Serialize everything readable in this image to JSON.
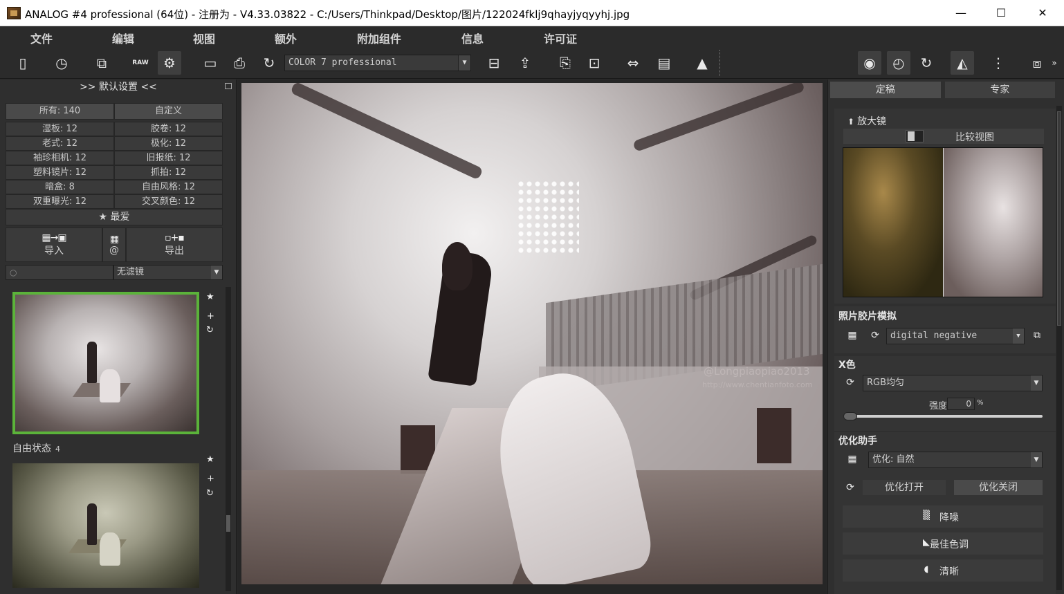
{
  "window": {
    "title": "ANALOG #4 professional (64位) - 注册为 - V4.33.03822 - C:/Users/Thinkpad/Desktop/图片/122024fklj9qhayjyqyyhj.jpg",
    "min_glyph": "—",
    "max_glyph": "☐",
    "close_glyph": "✕"
  },
  "menu": [
    "文件",
    "编辑",
    "视图",
    "额外",
    "附加组件",
    "信息",
    "许可证"
  ],
  "toolbar": {
    "preset": "COLOR 7 professional",
    "raw_label": "RAW"
  },
  "left_panel": {
    "header": ">> 默认设置 <<",
    "categories": [
      [
        "所有: 140",
        "自定义"
      ],
      [
        "湿板: 12",
        "胶卷: 12"
      ],
      [
        "老式: 12",
        "极化: 12"
      ],
      [
        "袖珍相机: 12",
        "旧报纸: 12"
      ],
      [
        "塑料镜片: 12",
        "抓拍: 12"
      ],
      [
        "暗盒: 8",
        "自由风格: 12"
      ],
      [
        "双重曝光: 12",
        "交叉颜色: 12"
      ]
    ],
    "favorites": "★ 最爱",
    "import_label": "导入",
    "export_label": "导出",
    "at_label": "@",
    "filter_value": "无滤镜",
    "group_label": "自由状态",
    "group_count": "4"
  },
  "main_image": {
    "watermark": "@Longpiaopiao2013",
    "watermark_url": "http://www.chentianfoto.com"
  },
  "right_panel": {
    "tabs": [
      "定稿",
      "专家"
    ],
    "magnifier": "放大镜",
    "compare_view": "比较视图",
    "film_section": "照片胶片模拟",
    "film_value": "digital negative",
    "xcolor_section": "X色",
    "xcolor_value": "RGB均匀",
    "strength_label": "强度",
    "strength_value": "0",
    "strength_unit": "%",
    "optimize_section": "优化助手",
    "optimize_value": "优化: 自然",
    "opt_on": "优化打开",
    "opt_off": "优化关闭",
    "tools": [
      "降噪",
      "最佳色调",
      "清晰"
    ]
  },
  "colors": {
    "accent_selection": "#5bb33a",
    "panel_bg": "#2f2f2f",
    "toolbar_bg": "#2b2b2b"
  }
}
